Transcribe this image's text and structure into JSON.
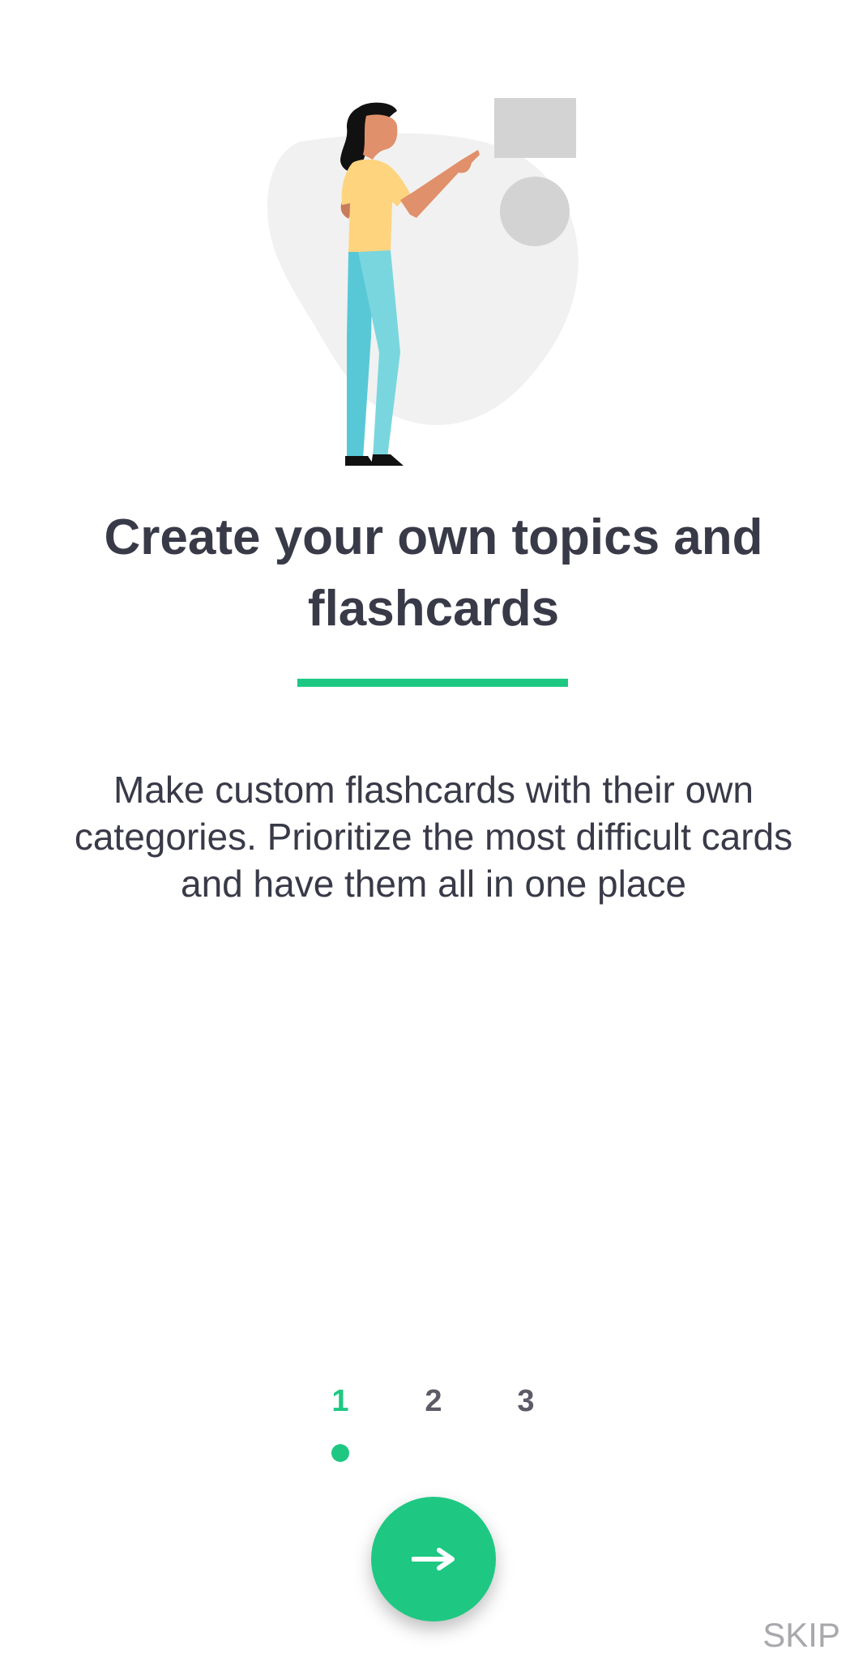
{
  "onboarding": {
    "title": "Create your own topics and flashcards",
    "description": "Make custom flashcards with their own categories. Prioritize the most difficult cards and have them all in one place",
    "pages": [
      "1",
      "2",
      "3"
    ],
    "active_page": 1,
    "next_icon": "arrow-right-icon",
    "skip_label": "SKIP"
  },
  "colors": {
    "accent": "#1ec883",
    "text": "#393a48",
    "muted": "#a8a8ad",
    "blob": "#f1f1f1",
    "shape": "#d3d3d3"
  },
  "illustration": {
    "subject": "woman pointing at shapes"
  }
}
